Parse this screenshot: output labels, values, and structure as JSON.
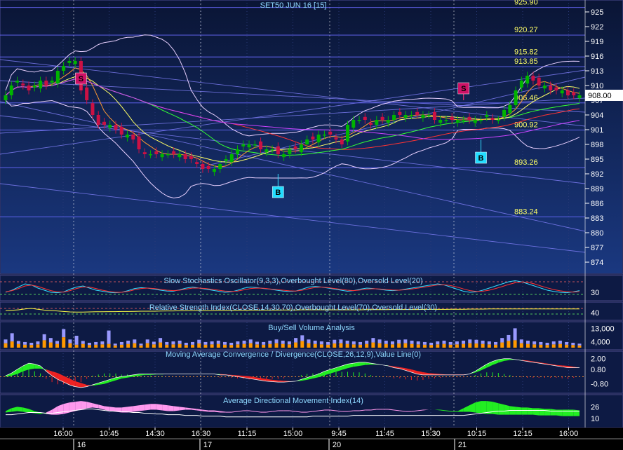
{
  "title": "SET50 JUN 16  [15]",
  "colors": {
    "bg": "#0b1638",
    "panel_bg": "#0e1c47",
    "grid": "#2a3a78",
    "axis_text": "#ffffff",
    "title_text": "#8fd8ff",
    "level_text": "#ffff66",
    "hline": "#6a6aff",
    "bull": "#00b400",
    "bear": "#cc1144",
    "last_price_bg": "#ffffff"
  },
  "chart_data": [
    {
      "type": "candlestick",
      "name": "price",
      "last_price": "908.00",
      "y_ticks": [
        "925",
        "922",
        "919",
        "916",
        "913",
        "910",
        "907",
        "904",
        "901",
        "898",
        "895",
        "892",
        "889",
        "886",
        "883",
        "880",
        "877",
        "874"
      ],
      "ylim": [
        872,
        927
      ],
      "levels": [
        {
          "label": "925.90",
          "value": 925.9
        },
        {
          "label": "920.27",
          "value": 920.27
        },
        {
          "label": "915.82",
          "value": 915.82
        },
        {
          "label": "913.85",
          "value": 913.85
        },
        {
          "label": "906.46",
          "value": 906.46
        },
        {
          "label": "900.92",
          "value": 900.92
        },
        {
          "label": "893.26",
          "value": 893.26
        },
        {
          "label": "883.24",
          "value": 883.24
        }
      ],
      "signals": [
        {
          "label": "S",
          "type": "sell",
          "bar": 13,
          "value": 909
        },
        {
          "label": "B",
          "type": "buy",
          "bar": 47,
          "value": 892
        },
        {
          "label": "S",
          "type": "sell",
          "bar": 79,
          "value": 907
        },
        {
          "label": "B",
          "type": "buy",
          "bar": 82,
          "value": 899
        }
      ],
      "closes": [
        908,
        910,
        911,
        910,
        909,
        910,
        911,
        910,
        911,
        913,
        914,
        915,
        915,
        909,
        907,
        904,
        902,
        902,
        902,
        901,
        900,
        900,
        899,
        897,
        896,
        896,
        896,
        896,
        896,
        896,
        896,
        895,
        895,
        894,
        893,
        893,
        893,
        894,
        895,
        896,
        897,
        898,
        898,
        898,
        897,
        897,
        897,
        896,
        896,
        897,
        897,
        898,
        899,
        899,
        900,
        900,
        900,
        899,
        898,
        902,
        903,
        903,
        903,
        902,
        903,
        903,
        903,
        904,
        904,
        904,
        904,
        904,
        904,
        904,
        903,
        903,
        903,
        903,
        903,
        903,
        903,
        903,
        903,
        904,
        903,
        903,
        905,
        906,
        909,
        911,
        912,
        911,
        910,
        910,
        909,
        909,
        909,
        908,
        908,
        908
      ]
    },
    {
      "type": "line",
      "name": "Slow Stochastics Oscillator(9,3,3),Overbought Level(80),Oversold Level(20)",
      "y_tick": "30",
      "series": [
        {
          "name": "%K",
          "values": [
            30,
            40,
            55,
            70,
            65,
            50,
            40,
            30,
            28,
            32,
            45,
            55,
            60,
            50,
            40,
            35,
            30,
            28,
            30,
            38,
            48,
            52,
            50,
            45,
            40,
            36,
            35,
            42,
            50,
            55,
            50,
            45,
            40,
            35,
            30,
            32,
            40,
            50,
            55,
            52,
            48,
            45,
            40,
            36,
            34,
            36,
            45,
            55,
            58,
            55,
            50,
            45,
            40,
            35,
            38,
            45,
            50,
            48,
            44,
            40,
            38,
            40,
            45,
            50,
            55,
            60,
            65,
            70,
            65,
            55,
            45,
            35,
            30,
            32,
            40,
            50,
            60,
            70,
            80,
            85,
            80,
            70,
            60,
            50,
            40,
            34,
            30,
            28,
            32,
            38
          ]
        },
        {
          "name": "%D",
          "values": [
            32,
            38,
            48,
            60,
            64,
            58,
            48,
            38,
            32,
            31,
            38,
            48,
            55,
            55,
            48,
            40,
            34,
            30,
            30,
            34,
            42,
            48,
            50,
            48,
            44,
            40,
            38,
            40,
            45,
            50,
            50,
            48,
            44,
            40,
            36,
            34,
            36,
            42,
            48,
            50,
            49,
            46,
            43,
            40,
            37,
            36,
            40,
            47,
            53,
            55,
            52,
            48,
            44,
            40,
            38,
            41,
            45,
            47,
            46,
            43,
            41,
            40,
            42,
            46,
            50,
            55,
            60,
            65,
            66,
            62,
            55,
            46,
            38,
            34,
            35,
            40,
            48,
            57,
            67,
            75,
            79,
            77,
            70,
            60,
            51,
            43,
            37,
            33,
            31,
            33
          ]
        }
      ]
    },
    {
      "type": "line",
      "name": "Relative Strength Index(CLOSE,14,30,70),Overbought Level(70),Oversold Level(30)",
      "y_tick": "40",
      "series": [
        {
          "name": "RSI",
          "values": [
            55,
            57,
            60,
            66,
            70,
            64,
            58,
            55,
            52,
            48,
            45,
            44,
            44,
            45,
            46,
            46,
            47,
            47,
            48,
            48,
            49,
            50,
            50,
            50,
            51,
            52,
            52,
            53,
            54,
            55,
            55,
            55,
            55,
            56,
            56,
            56,
            57,
            57,
            58,
            58,
            58,
            58,
            58,
            59,
            59,
            59,
            60,
            60,
            60,
            60,
            60,
            60,
            60,
            60,
            60,
            60,
            61,
            61,
            61,
            61,
            62,
            62,
            62,
            62,
            62,
            63,
            63,
            63,
            63,
            64,
            64,
            64,
            65,
            65,
            65,
            66,
            66,
            66,
            66,
            66,
            66,
            66,
            66,
            66,
            66,
            66,
            66,
            66,
            66,
            66
          ]
        }
      ]
    },
    {
      "type": "bar",
      "name": "Buy/Sell Volume Analysis",
      "y_ticks": [
        "13,000",
        "4,000"
      ],
      "ylim": [
        0,
        16000
      ],
      "buy": [
        3000,
        4200,
        2500,
        2000,
        1800,
        2200,
        5000,
        3500,
        2500,
        7000,
        3000,
        2000,
        2500,
        1800,
        2000,
        2200,
        2500,
        1500,
        2000,
        2500,
        3000,
        1500,
        3000,
        2200,
        3500,
        2000,
        2200,
        2500,
        1800,
        2000,
        2800,
        2000,
        2200,
        2500,
        2000,
        1800,
        2200,
        2500,
        3000,
        2200,
        2000,
        2500,
        3000,
        2500,
        2200,
        3500,
        4500,
        3000,
        2500,
        2200,
        2000,
        2800,
        3000,
        2500,
        2200,
        2000,
        2500,
        3500,
        3000,
        2500,
        2200,
        2800,
        3000,
        2500,
        2200,
        2000,
        1800,
        2200,
        2500,
        2000,
        2200,
        2500,
        3000,
        2800,
        2500,
        2200,
        2000,
        3500,
        4500,
        5000,
        3000,
        2500,
        2200,
        2000,
        1800,
        2200,
        2500,
        2000,
        1800,
        1500
      ],
      "sell": [
        2500,
        5500,
        2000,
        1800,
        1500,
        2000,
        4000,
        3000,
        2000,
        5500,
        2500,
        6000,
        2000,
        1500,
        1800,
        2000,
        9000,
        1200,
        1800,
        2200,
        2500,
        1200,
        2500,
        1800,
        3000,
        1800,
        2000,
        2200,
        1500,
        1800,
        2500,
        1800,
        2000,
        2200,
        1800,
        1500,
        2000,
        2200,
        2500,
        1800,
        1800,
        2200,
        2500,
        2200,
        2000,
        3000,
        3800,
        2500,
        2200,
        2000,
        1800,
        2500,
        2500,
        2200,
        2000,
        1800,
        2200,
        3000,
        2500,
        2200,
        2000,
        2500,
        2500,
        2200,
        2000,
        1800,
        1500,
        2000,
        2200,
        1800,
        2000,
        2200,
        2500,
        2500,
        2200,
        2000,
        1800,
        3000,
        4000,
        8000,
        2500,
        2200,
        2000,
        1800,
        1500,
        2000,
        2200,
        1800,
        1500,
        1200
      ]
    },
    {
      "type": "area",
      "name": "Moving Average Convergence / Divergence(CLOSE,26,12,9),Value Line(0)",
      "y_ticks": [
        "2.00",
        "0.80",
        "-0.80"
      ],
      "ylim": [
        -1.6,
        2.6
      ],
      "hist": [
        0.1,
        0.4,
        0.8,
        1.2,
        1.5,
        1.4,
        1.2,
        0.6,
        0.1,
        -0.3,
        -0.6,
        -0.9,
        -1.1,
        -1.2,
        -1.1,
        -0.9,
        -0.7,
        -0.5,
        -0.3,
        -0.1,
        0.0,
        0.1,
        0.2,
        0.3,
        0.3,
        0.3,
        0.3,
        0.3,
        0.3,
        0.3,
        0.3,
        0.3,
        0.3,
        0.3,
        0.3,
        0.3,
        0.3,
        0.2,
        0.2,
        0.1,
        0.0,
        -0.1,
        -0.2,
        -0.3,
        -0.4,
        -0.5,
        -0.55,
        -0.6,
        -0.6,
        -0.55,
        -0.5,
        -0.3,
        -0.1,
        0.1,
        0.3,
        0.6,
        0.8,
        1.0,
        1.2,
        1.4,
        1.5,
        1.6,
        1.6,
        1.5,
        1.4,
        1.3,
        1.2,
        1.0,
        0.9,
        0.7,
        0.5,
        0.3,
        0.2,
        0.2,
        0.2,
        0.2,
        0.2,
        0.2,
        0.2,
        0.2,
        0.3,
        0.6,
        1.0,
        1.4,
        1.7,
        1.9,
        2.0,
        2.0,
        1.9,
        1.8,
        1.7,
        1.6,
        1.5,
        1.4,
        1.3,
        1.2,
        1.1,
        1.0,
        1.0,
        1.0
      ],
      "signal": [
        0.0,
        0.1,
        0.3,
        0.6,
        0.8,
        0.9,
        0.9,
        0.8,
        0.6,
        0.4,
        0.1,
        -0.2,
        -0.5,
        -0.7,
        -0.9,
        -1.0,
        -0.9,
        -0.8,
        -0.6,
        -0.4,
        -0.2,
        -0.1,
        0.0,
        0.1,
        0.2,
        0.2,
        0.25,
        0.25,
        0.3,
        0.3,
        0.3,
        0.3,
        0.3,
        0.3,
        0.3,
        0.3,
        0.3,
        0.3,
        0.25,
        0.2,
        0.15,
        0.1,
        0.05,
        -0.05,
        -0.15,
        -0.25,
        -0.35,
        -0.4,
        -0.45,
        -0.5,
        -0.5,
        -0.45,
        -0.35,
        -0.2,
        -0.05,
        0.15,
        0.35,
        0.55,
        0.75,
        0.95,
        1.1,
        1.2,
        1.3,
        1.35,
        1.35,
        1.3,
        1.25,
        1.15,
        1.05,
        0.95,
        0.8,
        0.65,
        0.5,
        0.4,
        0.35,
        0.3,
        0.25,
        0.25,
        0.25,
        0.25,
        0.3,
        0.45,
        0.7,
        1.0,
        1.3,
        1.55,
        1.75,
        1.85,
        1.9,
        1.85,
        1.8,
        1.7,
        1.6,
        1.5,
        1.4,
        1.3,
        1.25,
        1.2,
        1.1,
        1.0
      ]
    },
    {
      "type": "area",
      "name": "Average Directional Movement Index(14)",
      "y_ticks": [
        "26",
        "10"
      ],
      "ylim": [
        0,
        40
      ],
      "di_plus": [
        20,
        24,
        26,
        25,
        23,
        20,
        18,
        16,
        15,
        15,
        16,
        18,
        20,
        22,
        24,
        25,
        24,
        22,
        20,
        19,
        18,
        18,
        19,
        20,
        21,
        22,
        22,
        21,
        20,
        20,
        21,
        22,
        22,
        21,
        20,
        19,
        19,
        18,
        18,
        18,
        19,
        20,
        20,
        19,
        18,
        18,
        19,
        20,
        20,
        20,
        19,
        18,
        18,
        19,
        20,
        21,
        21,
        20,
        19,
        19,
        20,
        20,
        21,
        21,
        22,
        22,
        22,
        21,
        20,
        19,
        19,
        20,
        21,
        22,
        22,
        22,
        21,
        20,
        20,
        24,
        28,
        32,
        34,
        34,
        33,
        31,
        29,
        27,
        26,
        25,
        25,
        24,
        24,
        23,
        23,
        22,
        22,
        22,
        22,
        21
      ],
      "di_minus": [
        18,
        19,
        20,
        19,
        18,
        17,
        16,
        18,
        22,
        27,
        30,
        32,
        33,
        34,
        33,
        31,
        29,
        27,
        26,
        25,
        25,
        26,
        27,
        28,
        29,
        30,
        30,
        29,
        28,
        27,
        26,
        25,
        24,
        23,
        22,
        21,
        21,
        20,
        19,
        19,
        20,
        21,
        21,
        20,
        19,
        19,
        20,
        21,
        21,
        21,
        20,
        19,
        19,
        20,
        21,
        22,
        22,
        21,
        20,
        20,
        21,
        21,
        22,
        22,
        23,
        23,
        23,
        22,
        21,
        20,
        20,
        21,
        22,
        22,
        22,
        21,
        20,
        19,
        19,
        19,
        19,
        18,
        17,
        16,
        16,
        15,
        15,
        15,
        15,
        15,
        15,
        15,
        14,
        14,
        14,
        14,
        13,
        13,
        13,
        13
      ],
      "adx": [
        15,
        15,
        16,
        17,
        18,
        18,
        18,
        17,
        17,
        18,
        19,
        20,
        21,
        22,
        23,
        23,
        22,
        21,
        20,
        20,
        19,
        19,
        18,
        18,
        17,
        17,
        16,
        16,
        15,
        15,
        15,
        14,
        14,
        14,
        13,
        13,
        13,
        13,
        12,
        12,
        12,
        12,
        12,
        12,
        12,
        12,
        12,
        12,
        12,
        12,
        12,
        12,
        12,
        13,
        13,
        13,
        13,
        13,
        13,
        13,
        14,
        14,
        14,
        14,
        14,
        14,
        14,
        14,
        14,
        14,
        14,
        14,
        14,
        14,
        14,
        14,
        14,
        14,
        14,
        14,
        15,
        16,
        17,
        18,
        19,
        20,
        20,
        21,
        21,
        21,
        21,
        21,
        21,
        21,
        20,
        20,
        20,
        20,
        20,
        20
      ]
    }
  ],
  "x_axis": {
    "time_labels": [
      "16:00",
      "10:45",
      "14:30",
      "16:30",
      "11:15",
      "15:00",
      "9:45",
      "11:45",
      "15:30",
      "10:15",
      "12:15",
      "16:00"
    ],
    "day_labels": [
      "16",
      "17",
      "20",
      "21"
    ]
  }
}
